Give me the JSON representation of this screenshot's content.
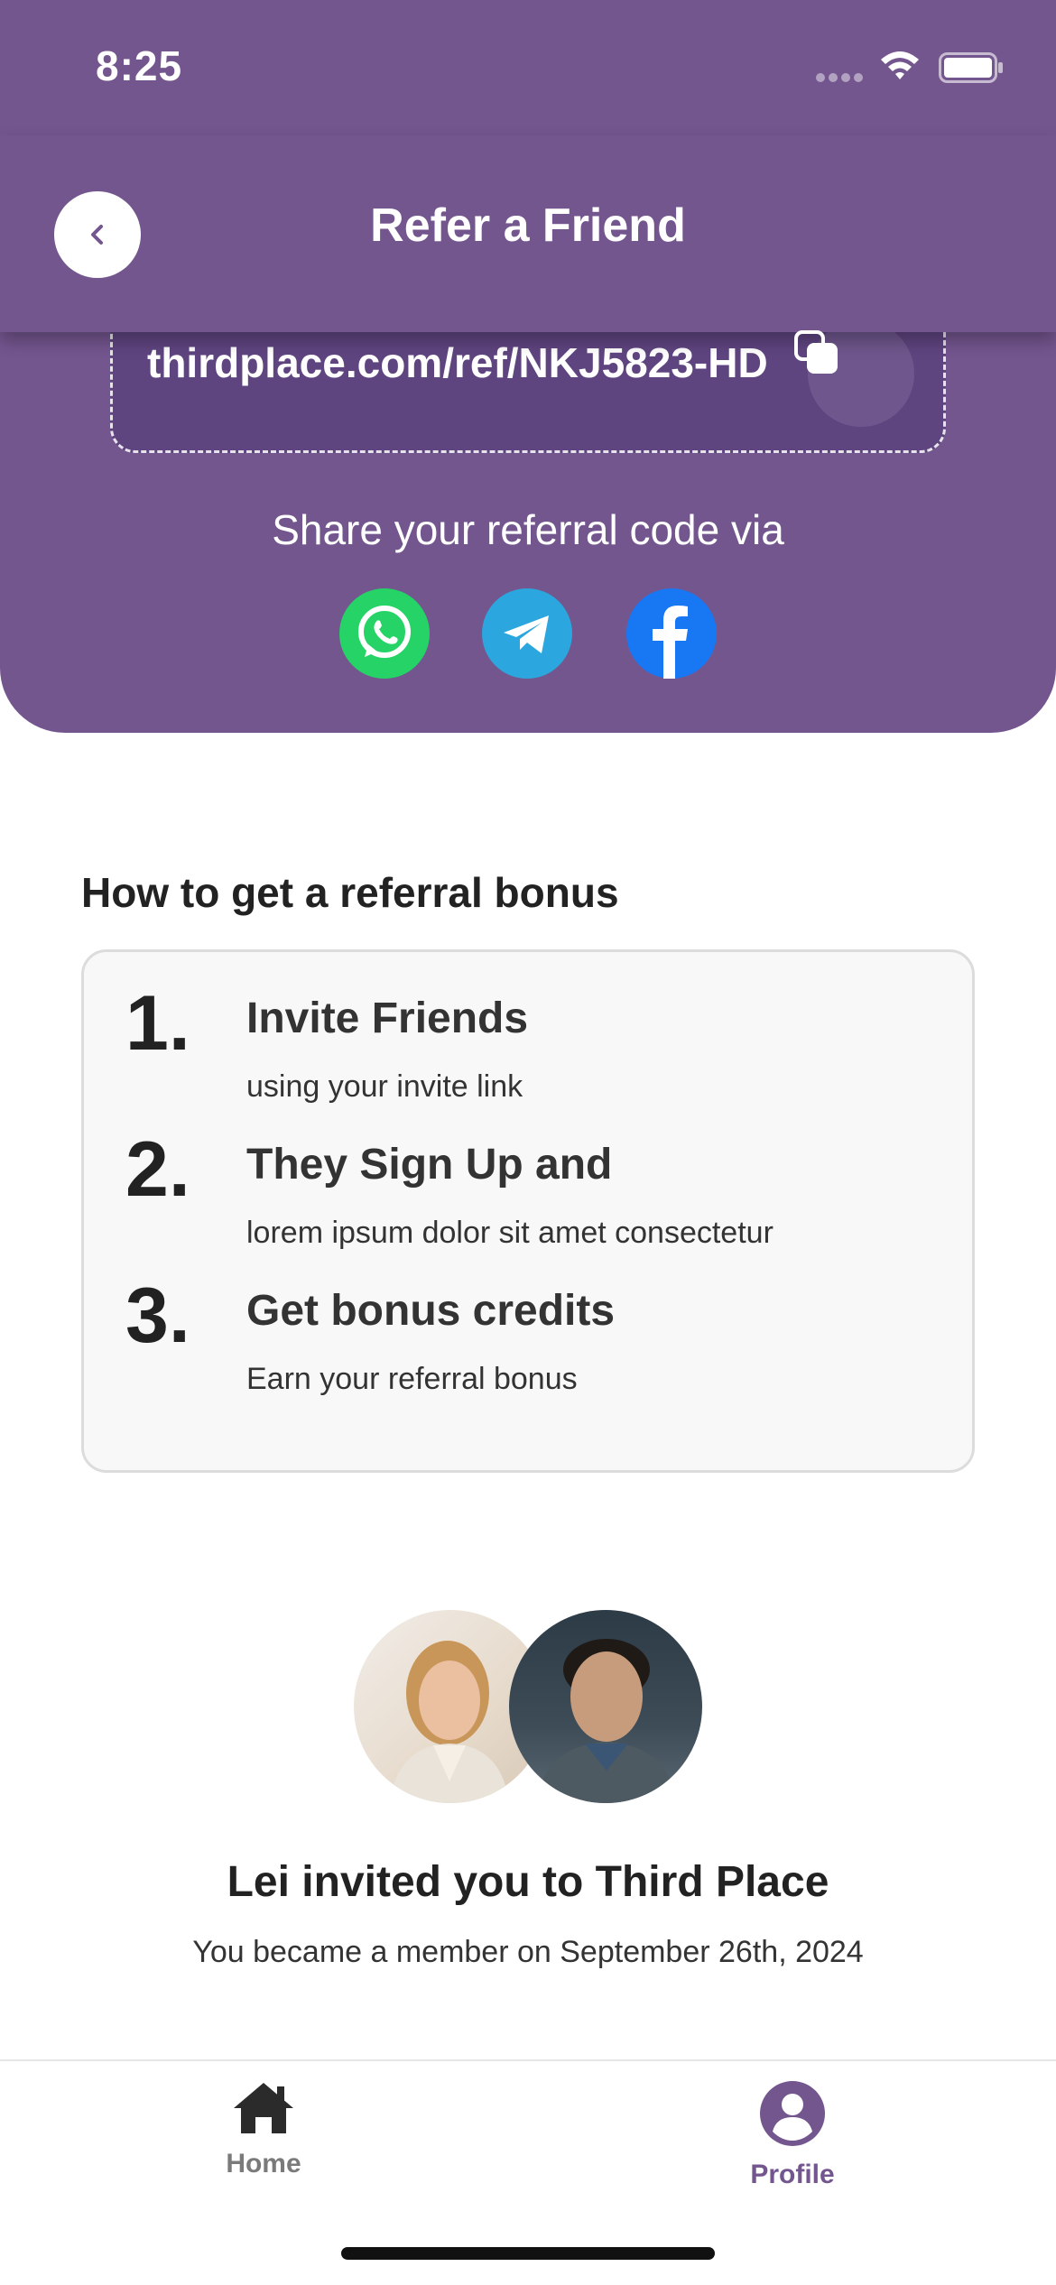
{
  "status_bar": {
    "time": "8:25",
    "icons": [
      "cellular-signal-icon",
      "wifi-icon",
      "battery-icon"
    ]
  },
  "header": {
    "title": "Refer a Friend",
    "back_icon": "chevron-left-icon"
  },
  "referral": {
    "code_url": "thirdplace.com/ref/NKJ5823-HD",
    "copy_icon": "copy-icon",
    "share_label": "Share your referral code via",
    "share_options": [
      "whatsapp-icon",
      "telegram-icon",
      "facebook-icon"
    ]
  },
  "how_to": {
    "title": "How to get a referral bonus",
    "steps": [
      {
        "number": "1.",
        "title": "Invite Friends",
        "subtitle": "using your invite link"
      },
      {
        "number": "2.",
        "title": "They Sign Up and",
        "subtitle": "lorem ipsum dolor sit amet consectetur"
      },
      {
        "number": "3.",
        "title": "Get bonus credits",
        "subtitle": "Earn your referral bonus"
      }
    ]
  },
  "invitation": {
    "title": "Lei invited you to Third Place",
    "member_since": "You became a member on September 26th, 2024"
  },
  "tab_bar": {
    "tabs": [
      {
        "label": "Home",
        "icon": "home-icon",
        "active": false
      },
      {
        "label": "Profile",
        "icon": "user-circle-icon",
        "active": true
      }
    ]
  },
  "colors": {
    "brand": "#74568f",
    "code_box": "#5f4580",
    "whatsapp": "#25d366",
    "telegram": "#2ba6de",
    "facebook": "#1877f2"
  }
}
